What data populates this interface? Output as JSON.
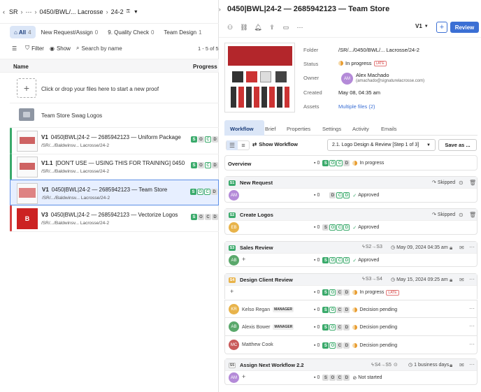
{
  "header": {
    "root": "SR",
    "ellipsis": "···",
    "crumb": "0450/BWL/... Lacrosse",
    "current": "24-2"
  },
  "tabs": [
    {
      "label": "All",
      "count": "4"
    },
    {
      "label": "New Request/Assign",
      "count": "0"
    },
    {
      "label": "9. Quality Check",
      "count": "0"
    },
    {
      "label": "Team Design",
      "count": "1"
    }
  ],
  "toolbar": {
    "filter": "Filter",
    "show": "Show",
    "search_placeholder": "Search by name",
    "pagination": "1 - 5 of 5"
  },
  "columns": {
    "name": "Name",
    "progress": "Progress"
  },
  "upload": {
    "label": "Click or drop your files here to start a new proof"
  },
  "folder": {
    "label": "Team Store Swag Logos"
  },
  "files": [
    {
      "version": "V1",
      "name": "0450|BWL|24-2 — 2685942123 — Uniform Package",
      "path": "/SR/.../Baldwinsv... Lacrosse/24-2"
    },
    {
      "version": "V1.1",
      "name": "[DON'T USE — USING THIS FOR TRAINING] 0450|BWL...",
      "path": "/SR/.../Baldwinsv... Lacrosse/24-2"
    },
    {
      "version": "V1",
      "name": "0450|BWL|24-2 — 2685942123 — Team Store",
      "path": "/SR/.../Baldwinsv... Lacrosse/24-2"
    },
    {
      "version": "V3",
      "name": "0450|BWL|24-2 — 2685942123 — Vectorize Logos",
      "path": "/SR/.../Baldwinsv... Lacrosse/24-2"
    }
  ],
  "detail": {
    "title": "0450|BWL|24-2 — 2685942123 — Team Store",
    "version": "V1",
    "review": "Review",
    "meta": {
      "folder_label": "Folder",
      "folder": "/SR/.../0450/BWL/... Lacrosse/24-2",
      "status_label": "Status",
      "status": "In progress",
      "late": "LATE",
      "owner_label": "Owner",
      "owner_name": "Alex Machado",
      "owner_email": "(amachado@signaturelacrosse.com)",
      "owner_initials": "AM",
      "created_label": "Created",
      "created": "May 08, 04:35 am",
      "assets_label": "Assets",
      "assets": "Multiple files (2)"
    },
    "tabs": [
      "Workflow",
      "Brief",
      "Properties",
      "Settings",
      "Activity",
      "Emails"
    ],
    "show_workflow": "Show Workflow",
    "workflow_select": "2.1. Logo Design & Review [Step 1 of 3]",
    "save_as": "Save as ...",
    "overview": {
      "label": "Overview",
      "comments": "0",
      "status": "In progress"
    },
    "steps": [
      {
        "num": "S1",
        "title": "New Request",
        "tag": "Skipped",
        "avatar": "AM",
        "comments": "0",
        "status": "Approved"
      },
      {
        "num": "S2",
        "title": "Create Logos",
        "tag": "Skipped",
        "avatar": "EB",
        "comments": "0",
        "status": "Approved"
      },
      {
        "num": "S3",
        "title": "Sales Review",
        "flow": "S2→S3",
        "date": "May 09, 2024 04:35 am",
        "avatar": "AB",
        "comments": "0",
        "status": "Approved"
      },
      {
        "num": "S4",
        "title": "Design Client Review",
        "flow": "S3→S4",
        "date": "May 15, 2024 09:25 am",
        "comments": "0",
        "status": "In progress",
        "late": "LATE"
      },
      {
        "num": "S5",
        "title": "Assign Next Workflow 2.2",
        "flow": "S4→S5",
        "date": "1 business days",
        "avatar": "AM",
        "comments": "0",
        "status": "Not started"
      }
    ],
    "members": [
      {
        "initials": "KR",
        "name": "Kelso Regan",
        "role": "MANAGER",
        "comments": "0",
        "status": "Decision pending"
      },
      {
        "initials": "AB",
        "name": "Alexis Bower",
        "role": "MANAGER",
        "comments": "0",
        "status": "Decision pending"
      },
      {
        "initials": "MC",
        "name": "Matthew Cook",
        "role": "",
        "comments": "0",
        "status": "Decision pending"
      }
    ]
  },
  "colors": {
    "accent": "#3b6fd4",
    "green": "#3aaa6b",
    "late": "#d54040",
    "orange": "#e89a2c"
  }
}
